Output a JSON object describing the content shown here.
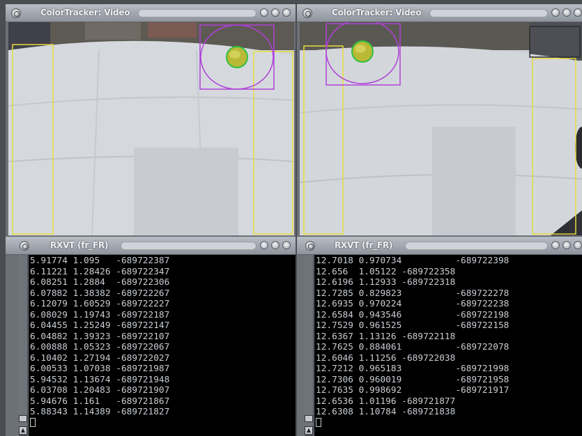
{
  "windows": {
    "video_left": {
      "title": "ColorTracker: Video"
    },
    "video_right": {
      "title": "ColorTracker: Video"
    },
    "term_left": {
      "title": "RXVT (fr_FR)"
    },
    "term_right": {
      "title": "RXVT (fr_FR)"
    }
  },
  "terminals": {
    "left": [
      "5.91774 1.095   -689722387",
      "6.11221 1.28426 -689722347",
      "6.08251 1.2884  -689722306",
      "6.07882 1.38382 -689722267",
      "6.12079 1.60529 -689722227",
      "6.08029 1.19743 -689722187",
      "6.04455 1.25249 -689722147",
      "6.04882 1.39323 -689722107",
      "6.00888 1.05323 -689722067",
      "6.10402 1.27194 -689722027",
      "6.00533 1.07038 -689721987",
      "5.94532 1.13674 -689721948",
      "6.03708 1.20483 -689721907",
      "5.94676 1.161   -689721867",
      "5.88343 1.14389 -689721827"
    ],
    "right": [
      "12.7018 0.970734          -689722398",
      "12.656  1.05122 -689722358",
      "12.6196 1.12933 -689722318",
      "12.7285 0.829823          -689722278",
      "12.6935 0.970224          -689722238",
      "12.6584 0.943546          -689722198",
      "12.7529 0.961525          -689722158",
      "12.6367 1.13126 -689722118",
      "12.7625 0.884061          -689722078",
      "12.6046 1.11256 -689722038",
      "12.7212 0.965183          -689721998",
      "12.7306 0.960019          -689721958",
      "12.7635 0.998692          -689721917",
      "12.6536 1.01196 -689721877",
      "12.6308 1.10784 -689721838"
    ]
  },
  "colors": {
    "tracking_box": "#b040d8",
    "region_box": "#e8dc3a",
    "ball": "#b9b936",
    "ball_outline": "#2fbf3f",
    "terminal_bg": "#000000",
    "terminal_fg": "#c9cdd2"
  },
  "icons": {
    "window_menu": "circle-icon",
    "window_controls": [
      "iconify-icon",
      "maximize-icon",
      "close-icon"
    ],
    "scroll_up": "arrow-up-icon",
    "scroll_down": "arrow-down-icon"
  }
}
